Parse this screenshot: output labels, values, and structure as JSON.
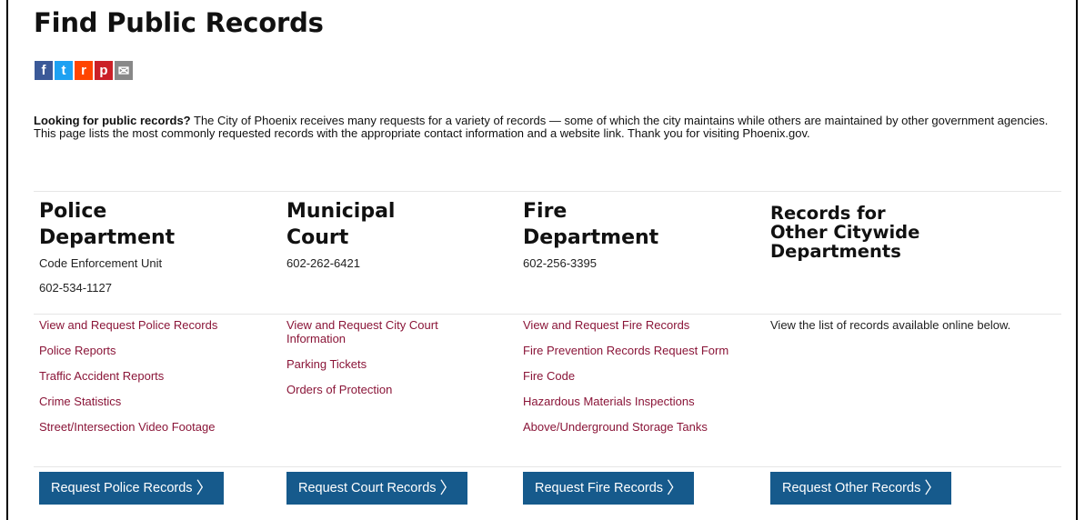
{
  "page": {
    "title": "Find Public Records"
  },
  "share": [
    {
      "label": "f",
      "color": "#3b5998",
      "name": "facebook-icon"
    },
    {
      "label": "t",
      "color": "#1da1f2",
      "name": "twitter-icon"
    },
    {
      "label": "r",
      "color": "#ff4500",
      "name": "reddit-icon"
    },
    {
      "label": "p",
      "color": "#cb2027",
      "name": "pinterest-icon"
    },
    {
      "label": "✉",
      "color": "#888888",
      "name": "email-icon"
    }
  ],
  "intro": {
    "lead": "Looking for public records?",
    "body": " The City of Phoenix receives many requests for a variety of records — some of which the city maintains while others are maintained by other government agencies. This page lists the most commonly requested records with the appropriate contact information and a website link. Thank you for visiting Phoenix.gov."
  },
  "columns": [
    {
      "heading_line1": "Police",
      "heading_line2": "Department",
      "meta": [
        "Code Enforcement Unit",
        "602-534-1127"
      ],
      "links": [
        "View and Request Police Records",
        "Police Reports",
        "Traffic Accident Reports",
        "Crime Statistics",
        "Street/Intersection Video Footage"
      ],
      "button": "Request Police Records"
    },
    {
      "heading_line1": "Municipal",
      "heading_line2": "Court",
      "meta": [
        "602-262-6421"
      ],
      "links": [
        "View and Request City Court Information",
        "Parking Tickets",
        "Orders of Protection"
      ],
      "button": "Request Court Records"
    },
    {
      "heading_line1": "Fire",
      "heading_line2": "Department",
      "meta": [
        "602-256-3395"
      ],
      "links": [
        "View and Request Fire Records",
        "Fire Prevention Records Request Form",
        "Fire Code",
        "Hazardous Materials Inspections",
        "Above/Underground Storage Tanks"
      ],
      "button": "Request Fire Records"
    },
    {
      "heading_line1": "Records for",
      "heading_line2": "Other Citywide",
      "heading_line3": "Departments",
      "text": "View the list of records available online below.",
      "button": "Request Other Records"
    }
  ],
  "colors": {
    "link": "#8a1538",
    "button": "#165a8c"
  }
}
